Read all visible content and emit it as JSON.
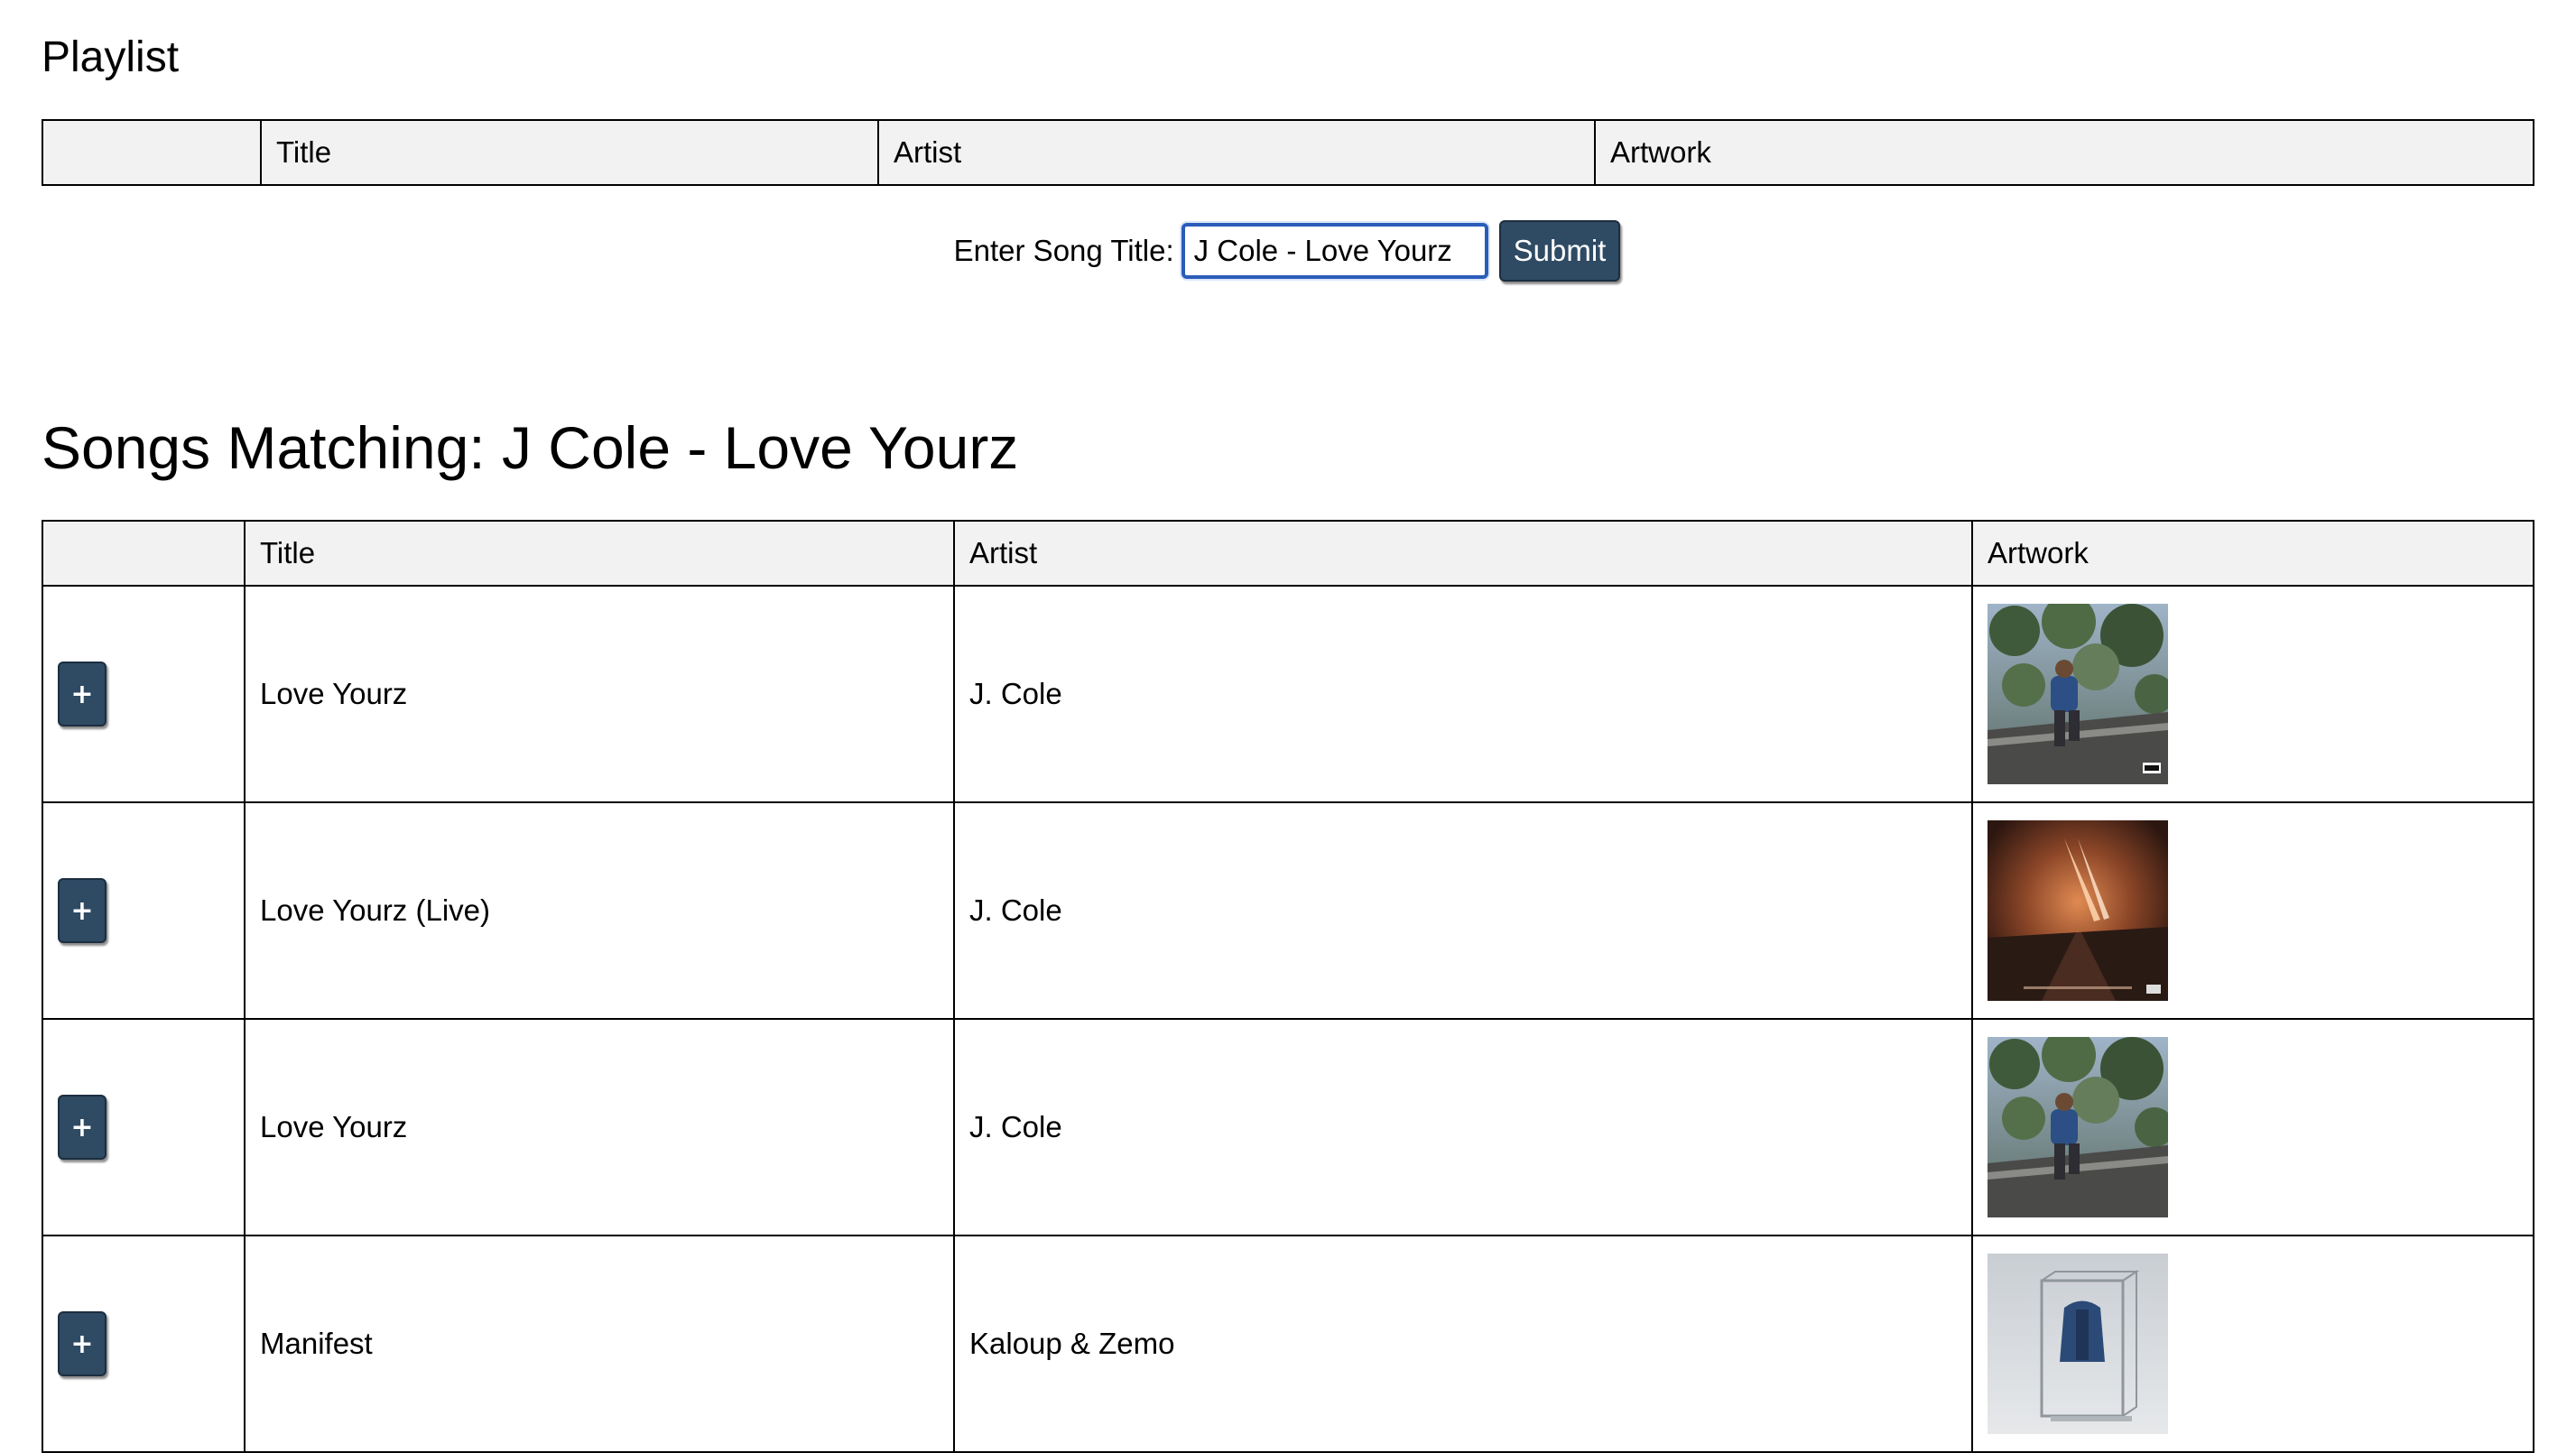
{
  "playlist": {
    "title": "Playlist",
    "columns": [
      "",
      "Title",
      "Artist",
      "Artwork"
    ]
  },
  "search": {
    "label": "Enter Song Title:",
    "value": "J Cole - Love Yourz",
    "submit_label": "Submit"
  },
  "results": {
    "heading": "Songs Matching: J Cole - Love Yourz",
    "columns": [
      "",
      "Title",
      "Artist",
      "Artwork"
    ],
    "add_label": "+",
    "rows": [
      {
        "title": "Love Yourz",
        "artist": "J. Cole",
        "artwork": "forest-hills-drive-cover"
      },
      {
        "title": "Love Yourz (Live)",
        "artist": "J. Cole",
        "artwork": "forest-hills-drive-live-cover"
      },
      {
        "title": "Love Yourz",
        "artist": "J. Cole",
        "artwork": "forest-hills-drive-cover"
      },
      {
        "title": "Manifest",
        "artist": "Kaloup & Zemo",
        "artwork": "manifest-cover"
      }
    ]
  }
}
